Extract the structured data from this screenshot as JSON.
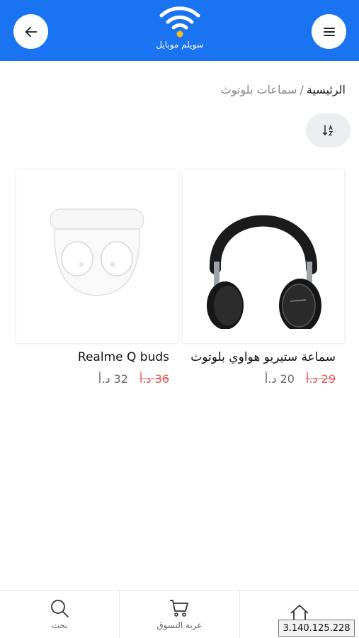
{
  "header": {
    "brand_name": "سويلم موبايل",
    "back_icon": "arrow-left-icon",
    "menu_icon": "hamburger-menu-icon",
    "logo_icon": "wifi-icon",
    "colors": {
      "bar": "#1a73f0",
      "logo_dot": "#f5c518"
    }
  },
  "breadcrumb": {
    "home": "الرئيسية",
    "separator": "/",
    "current": "سماعات بلوتوث"
  },
  "sort": {
    "icon": "sort-alpha-icon"
  },
  "products": [
    {
      "name": "سماعة ستيريو هواوي بلوتوث",
      "price": "20 د.أ",
      "old_price": "29 د.أ",
      "image": "over-ear-headphones"
    },
    {
      "name": "Realme Q buds",
      "price": "32 د.أ",
      "old_price": "36 د.أ",
      "image": "wireless-earbuds-case"
    }
  ],
  "bottom_nav": {
    "items": [
      {
        "label": "بحث",
        "icon": "search-icon"
      },
      {
        "label": "عربة التسوق",
        "icon": "cart-icon"
      },
      {
        "label": "",
        "icon": "home-icon"
      }
    ]
  },
  "overlay": {
    "ip": "3.140.125.228"
  },
  "colors": {
    "old_price": "#e25555",
    "price": "#666666"
  }
}
